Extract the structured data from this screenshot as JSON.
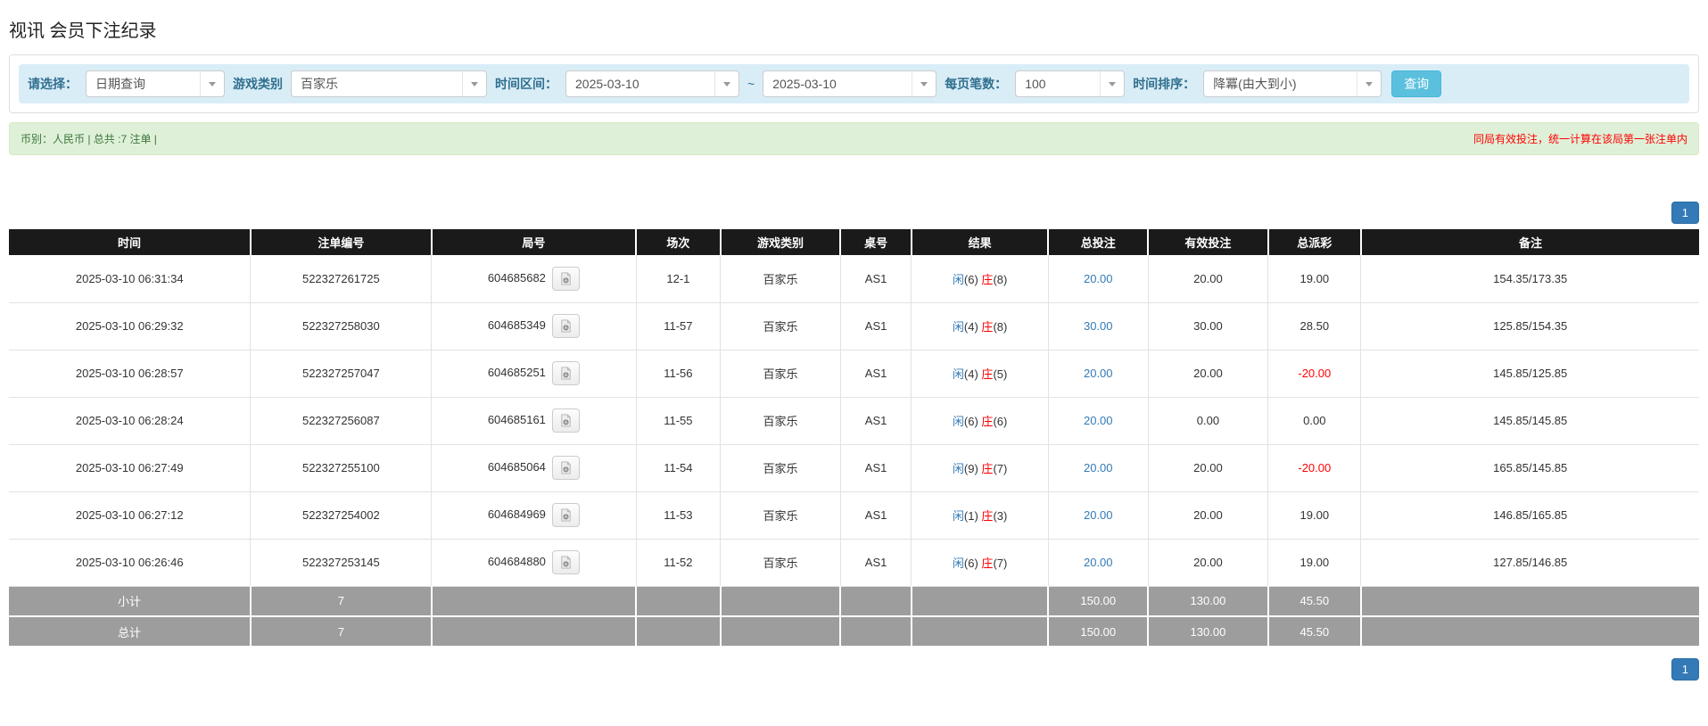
{
  "page_title": "视讯 会员下注纪录",
  "filters": {
    "select_label": "请选择：",
    "select_value": "日期查询",
    "game_label": "游戏类别",
    "game_value": "百家乐",
    "range_label": "时间区间：",
    "date_from": "2025-03-10",
    "range_separator": "~",
    "date_to": "2025-03-10",
    "page_size_label": "每页笔数：",
    "page_size_value": "100",
    "sort_label": "时间排序：",
    "sort_value": "降冪(由大到小)",
    "search_label": "查询"
  },
  "summary_bar": {
    "left": "币别：人民币 | 总共 :7 注单 |",
    "right": "同局有效投注，统一计算在该局第一张注单内"
  },
  "pagination": {
    "page": "1"
  },
  "table": {
    "headers": [
      "时间",
      "注单编号",
      "局号",
      "场次",
      "游戏类别",
      "桌号",
      "结果",
      "总投注",
      "有效投注",
      "总派彩",
      "备注"
    ],
    "rows": [
      {
        "time": "2025-03-10 06:31:34",
        "bet_id": "522327261725",
        "round_id": "604685682",
        "session": "12-1",
        "game": "百家乐",
        "table_no": "AS1",
        "player_label": "闲",
        "player_num": "(6)",
        "banker_label": "庄",
        "banker_num": "(8)",
        "total_bet": "20.00",
        "valid_bet": "20.00",
        "payout": "19.00",
        "payout_neg": false,
        "note": "154.35/173.35"
      },
      {
        "time": "2025-03-10 06:29:32",
        "bet_id": "522327258030",
        "round_id": "604685349",
        "session": "11-57",
        "game": "百家乐",
        "table_no": "AS1",
        "player_label": "闲",
        "player_num": "(4)",
        "banker_label": "庄",
        "banker_num": "(8)",
        "total_bet": "30.00",
        "valid_bet": "30.00",
        "payout": "28.50",
        "payout_neg": false,
        "note": "125.85/154.35"
      },
      {
        "time": "2025-03-10 06:28:57",
        "bet_id": "522327257047",
        "round_id": "604685251",
        "session": "11-56",
        "game": "百家乐",
        "table_no": "AS1",
        "player_label": "闲",
        "player_num": "(4)",
        "banker_label": "庄",
        "banker_num": "(5)",
        "total_bet": "20.00",
        "valid_bet": "20.00",
        "payout": "-20.00",
        "payout_neg": true,
        "note": "145.85/125.85"
      },
      {
        "time": "2025-03-10 06:28:24",
        "bet_id": "522327256087",
        "round_id": "604685161",
        "session": "11-55",
        "game": "百家乐",
        "table_no": "AS1",
        "player_label": "闲",
        "player_num": "(6)",
        "banker_label": "庄",
        "banker_num": "(6)",
        "total_bet": "20.00",
        "valid_bet": "0.00",
        "payout": "0.00",
        "payout_neg": false,
        "note": "145.85/145.85"
      },
      {
        "time": "2025-03-10 06:27:49",
        "bet_id": "522327255100",
        "round_id": "604685064",
        "session": "11-54",
        "game": "百家乐",
        "table_no": "AS1",
        "player_label": "闲",
        "player_num": "(9)",
        "banker_label": "庄",
        "banker_num": "(7)",
        "total_bet": "20.00",
        "valid_bet": "20.00",
        "payout": "-20.00",
        "payout_neg": true,
        "note": "165.85/145.85"
      },
      {
        "time": "2025-03-10 06:27:12",
        "bet_id": "522327254002",
        "round_id": "604684969",
        "session": "11-53",
        "game": "百家乐",
        "table_no": "AS1",
        "player_label": "闲",
        "player_num": "(1)",
        "banker_label": "庄",
        "banker_num": "(3)",
        "total_bet": "20.00",
        "valid_bet": "20.00",
        "payout": "19.00",
        "payout_neg": false,
        "note": "146.85/165.85"
      },
      {
        "time": "2025-03-10 06:26:46",
        "bet_id": "522327253145",
        "round_id": "604684880",
        "session": "11-52",
        "game": "百家乐",
        "table_no": "AS1",
        "player_label": "闲",
        "player_num": "(6)",
        "banker_label": "庄",
        "banker_num": "(7)",
        "total_bet": "20.00",
        "valid_bet": "20.00",
        "payout": "19.00",
        "payout_neg": false,
        "note": "127.85/146.85"
      }
    ],
    "subtotal": {
      "label": "小计",
      "count": "7",
      "total_bet": "150.00",
      "valid_bet": "130.00",
      "payout": "45.50"
    },
    "total": {
      "label": "总计",
      "count": "7",
      "total_bet": "150.00",
      "valid_bet": "130.00",
      "payout": "45.50"
    }
  },
  "icons": {
    "combo_caret": "caret-down-icon",
    "round_video": "video-replay-icon"
  },
  "colors": {
    "accent_blue": "#337ab7",
    "search_button_bg": "#5bc0de",
    "player_blue": "#337ab7",
    "banker_red": "#ff0000",
    "negative_red": "#ff0000",
    "table_header_bg": "#1a1a1a",
    "summary_row_bg": "#9d9d9d",
    "filter_bar_bg": "#d9edf7",
    "filter_label_text": "#31708f",
    "notice_bar_bg": "#dff0d8",
    "notice_text_green": "#3c763d",
    "notice_text_red": "#ff0000"
  }
}
